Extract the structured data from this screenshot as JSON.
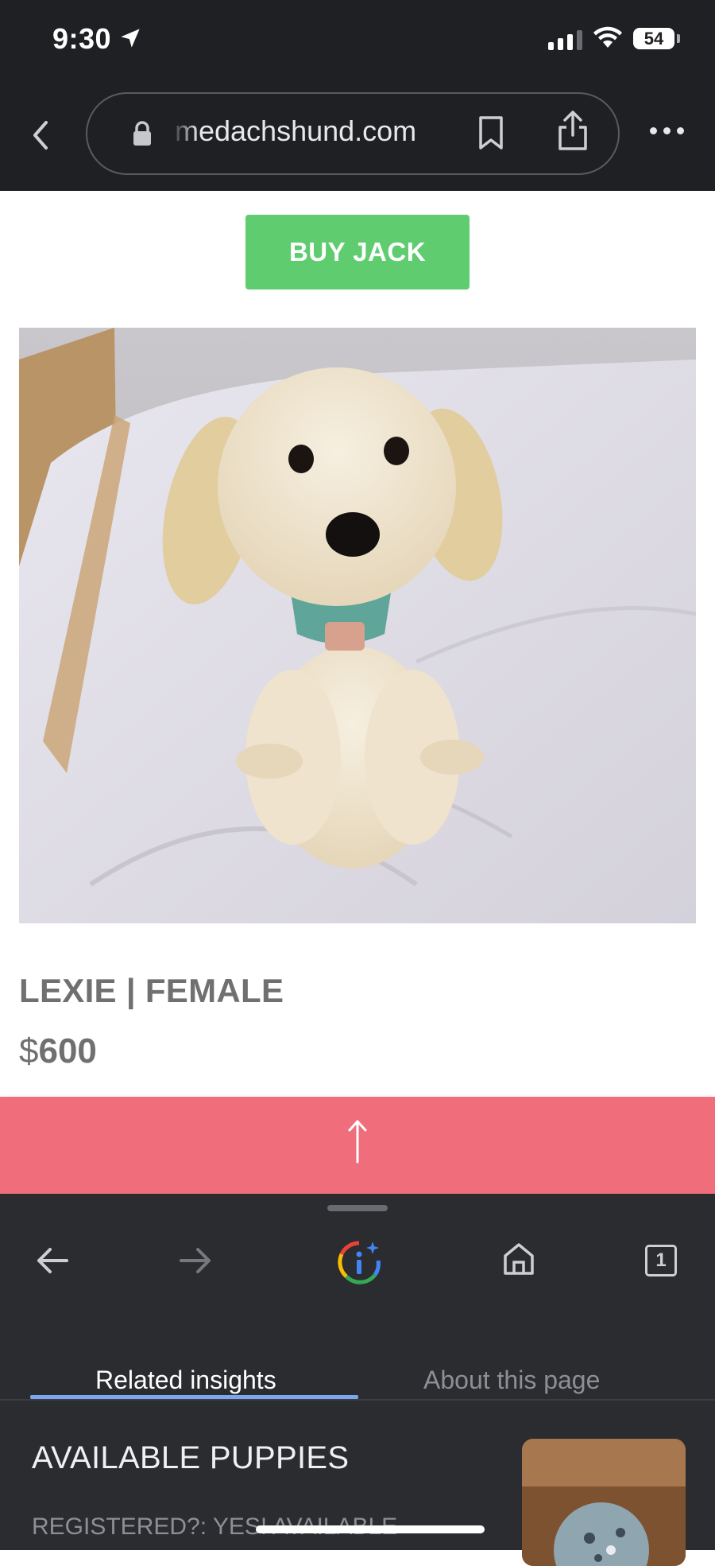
{
  "status_bar": {
    "time": "9:30",
    "battery": "54"
  },
  "browser": {
    "url": "medachshund.com"
  },
  "page": {
    "buy_button": "BUY JACK",
    "puppy_name": "LEXIE | FEMALE",
    "price_currency": "$",
    "price_amount": "600"
  },
  "scroll_top": {
    "arrow": "↑"
  },
  "bottom_toolbar": {
    "tab_count": "1"
  },
  "insights": {
    "tabs": [
      {
        "label": "Related insights",
        "active": true
      },
      {
        "label": "About this page",
        "active": false
      }
    ],
    "card": {
      "title": "AVAILABLE PUPPIES",
      "subtitle": "REGISTERED?: YES! AVAILABLE"
    }
  },
  "colors": {
    "buy_button": "#5fcc6f",
    "scroll_top_bar": "#f06e7c",
    "active_tab_underline": "#7aa7f0"
  }
}
